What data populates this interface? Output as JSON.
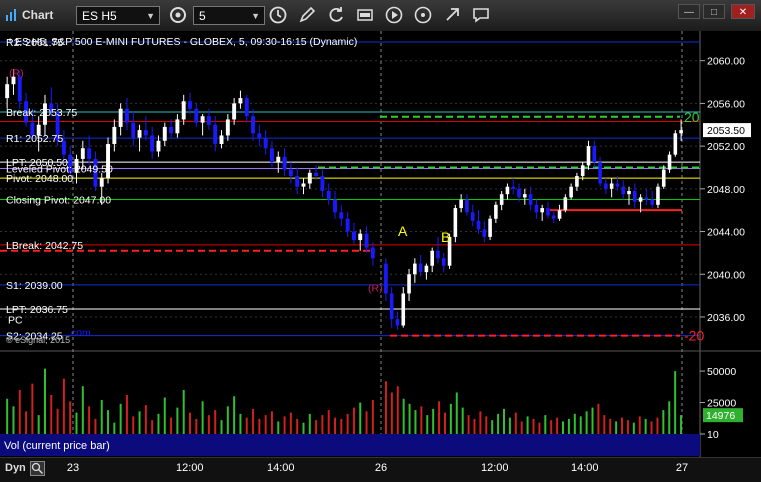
{
  "window": {
    "title": "Chart"
  },
  "toolbar": {
    "symbol": "ES H5",
    "interval": "5",
    "buttons": [
      "clock-settings-icon",
      "interval-clock-icon",
      "draw-pencil-icon",
      "refresh-icon",
      "gsc-icon",
      "play-icon",
      "link-icon",
      "chat-icon"
    ]
  },
  "window_buttons": [
    "—",
    "□",
    "✕"
  ],
  "header_text": "* ES H5, S&P 500 E-MINI FUTURES - GLOBEX, 5, 09:30-16:15 (Dynamic)",
  "header_partial_top": "R2: 2061.75",
  "watermark": "© eSignal, 2015",
  "study_label": "Vol (current price bar)",
  "bottom": {
    "mode": "Dyn"
  },
  "colors": {
    "up": "#ffffff",
    "down": "#1a1aff",
    "grid": "#333333",
    "axis_text": "#ffffff",
    "green": "#00cc00",
    "red": "#e00000",
    "yellow": "#ffff00",
    "blue_line": "#1030d0",
    "purple": "#a070ff",
    "teal": "#30c0c0"
  },
  "chart_data": {
    "type": "candlestick",
    "title": "* ES H5, S&P 500 E-MINI FUTURES - GLOBEX, 5, 09:30-16:15 (Dynamic)",
    "ylim": [
      2033.0,
      2062.5
    ],
    "y_ticks": [
      "2036.00",
      "2040.00",
      "2044.00",
      "2048.00",
      "2052.00",
      "2056.00",
      "2060.00"
    ],
    "x_ticks": [
      "23",
      "12:00",
      "14:00",
      "26",
      "12:00",
      "14:00",
      "27"
    ],
    "last_price": "2053.50",
    "levels": [
      {
        "label": "R2: 2061.75",
        "value": 2061.75,
        "color": "#1030d0",
        "style": "solid"
      },
      {
        "label": "Break: 2053.75",
        "value": 2055.2,
        "color": "#30c0c0",
        "style": "solid"
      },
      {
        "label": "",
        "value": 2054.3,
        "color": "#e00000",
        "style": "solid"
      },
      {
        "label": "R1: 2052.75",
        "value": 2052.75,
        "color": "#1030d0",
        "style": "solid"
      },
      {
        "label": "LPT: 2050.50",
        "value": 2050.5,
        "color": "#ffffff",
        "style": "solid"
      },
      {
        "label": "Leveled Pivot: 2049.50",
        "value": 2049.9,
        "color": "#a070ff",
        "style": "solid"
      },
      {
        "label": "Pivot: 2048.00",
        "value": 2049.0,
        "color": "#ffff00",
        "style": "solid"
      },
      {
        "label": "Closing Pivot: 2047.00",
        "value": 2047.0,
        "color": "#00cc00",
        "style": "solid"
      },
      {
        "label": "LBreak: 2042.75",
        "value": 2042.75,
        "color": "#e00000",
        "style": "solid"
      },
      {
        "label": "S1: 2039.00",
        "value": 2039.0,
        "color": "#1030d0",
        "style": "solid"
      },
      {
        "label": "LPT: 2036.75",
        "value": 2036.75,
        "color": "#ffffff",
        "style": "solid"
      },
      {
        "label": "S2: 2034.25",
        "value": 2034.25,
        "color": "#1030d0",
        "style": "solid"
      }
    ],
    "dashed_levels": [
      {
        "value": 2042.2,
        "color": "#ff2020",
        "x_from": 0,
        "x_to": 372
      },
      {
        "value": 2054.75,
        "color": "#33cc33",
        "x_from": 380,
        "x_to": 680,
        "tag": "20"
      },
      {
        "value": 2050.0,
        "color": "#33cc33",
        "x_from": 318,
        "x_to": 700
      },
      {
        "value": 2034.25,
        "color": "#ff2020",
        "x_from": 390,
        "x_to": 680,
        "tag": "-20"
      },
      {
        "value": 2046.0,
        "color": "#ff2020",
        "x_from": 550,
        "x_to": 682,
        "dashed": false
      }
    ],
    "annotations": [
      {
        "text": "A",
        "color": "#ffff00",
        "x": 398,
        "value": 2043.6
      },
      {
        "text": "B",
        "color": "#ffff00",
        "x": 441,
        "value": 2043.0
      },
      {
        "text": "(R)",
        "color": "#c02060",
        "x": 368,
        "value": 2038.4
      },
      {
        "text": "(R)",
        "color": "#c02060",
        "x": 9,
        "value": 2058.5
      },
      {
        "text": "PC",
        "color": "#ffffff",
        "x": 8,
        "value": 2035.4
      },
      {
        "text": ".com",
        "color": "#1a1aff",
        "x": 68,
        "value": 2034.2
      }
    ],
    "candles_day1": [
      [
        2056.5,
        2058.5,
        2055.5,
        2057.8
      ],
      [
        2057.8,
        2059.2,
        2056.8,
        2058.5
      ],
      [
        2058.5,
        2059.0,
        2055.5,
        2056.2
      ],
      [
        2056.2,
        2057.0,
        2053.8,
        2054.2
      ],
      [
        2054.2,
        2055.5,
        2052.5,
        2053.0
      ],
      [
        2053.0,
        2054.8,
        2051.5,
        2054.0
      ],
      [
        2054.0,
        2056.8,
        2053.0,
        2056.0
      ],
      [
        2056.0,
        2057.5,
        2054.8,
        2055.2
      ],
      [
        2055.2,
        2056.0,
        2052.0,
        2052.5
      ],
      [
        2052.5,
        2053.5,
        2050.5,
        2051.2
      ],
      [
        2051.2,
        2052.0,
        2049.0,
        2049.5
      ],
      [
        2049.5,
        2051.2,
        2048.5,
        2050.8
      ],
      [
        2050.8,
        2052.5,
        2049.8,
        2051.8
      ],
      [
        2051.8,
        2053.0,
        2050.2,
        2050.8
      ],
      [
        2050.8,
        2051.5,
        2047.8,
        2048.2
      ],
      [
        2048.2,
        2049.5,
        2046.5,
        2049.0
      ],
      [
        2049.0,
        2052.8,
        2048.5,
        2052.2
      ],
      [
        2052.2,
        2054.5,
        2051.5,
        2053.8
      ],
      [
        2053.8,
        2056.0,
        2053.0,
        2055.5
      ],
      [
        2055.5,
        2056.5,
        2053.5,
        2054.2
      ],
      [
        2054.2,
        2055.2,
        2052.0,
        2052.8
      ],
      [
        2052.8,
        2054.0,
        2051.5,
        2053.5
      ],
      [
        2053.5,
        2054.8,
        2052.5,
        2053.0
      ],
      [
        2053.0,
        2053.8,
        2050.8,
        2051.5
      ],
      [
        2051.5,
        2053.0,
        2051.0,
        2052.5
      ],
      [
        2052.5,
        2054.2,
        2052.0,
        2053.8
      ],
      [
        2053.8,
        2054.5,
        2052.8,
        2053.2
      ],
      [
        2053.2,
        2055.0,
        2052.8,
        2054.5
      ],
      [
        2054.5,
        2056.8,
        2054.0,
        2056.2
      ],
      [
        2056.2,
        2057.0,
        2055.0,
        2055.5
      ],
      [
        2055.5,
        2056.0,
        2053.8,
        2054.2
      ],
      [
        2054.2,
        2055.0,
        2053.0,
        2054.8
      ],
      [
        2054.8,
        2055.5,
        2053.5,
        2054.0
      ],
      [
        2054.0,
        2054.8,
        2051.5,
        2052.2
      ],
      [
        2052.2,
        2053.5,
        2051.8,
        2053.0
      ],
      [
        2053.0,
        2055.0,
        2052.5,
        2054.5
      ],
      [
        2054.5,
        2056.5,
        2054.0,
        2056.0
      ],
      [
        2056.0,
        2057.2,
        2055.5,
        2056.5
      ],
      [
        2056.5,
        2056.8,
        2054.2,
        2054.8
      ],
      [
        2054.8,
        2055.5,
        2052.5,
        2053.2
      ],
      [
        2053.2,
        2054.0,
        2052.0,
        2052.8
      ],
      [
        2052.8,
        2053.5,
        2051.2,
        2051.8
      ],
      [
        2051.8,
        2052.5,
        2050.0,
        2050.5
      ],
      [
        2050.5,
        2051.5,
        2049.5,
        2051.0
      ],
      [
        2051.0,
        2051.8,
        2049.2,
        2049.8
      ],
      [
        2049.8,
        2050.5,
        2048.5,
        2049.2
      ],
      [
        2049.2,
        2050.0,
        2047.5,
        2048.2
      ],
      [
        2048.2,
        2049.0,
        2047.5,
        2048.5
      ],
      [
        2048.5,
        2049.8,
        2048.0,
        2049.5
      ],
      [
        2049.5,
        2050.2,
        2048.8,
        2049.2
      ],
      [
        2049.2,
        2049.8,
        2047.2,
        2047.8
      ],
      [
        2047.8,
        2048.5,
        2046.5,
        2047.0
      ],
      [
        2047.0,
        2047.8,
        2045.2,
        2045.8
      ],
      [
        2045.8,
        2046.5,
        2044.5,
        2045.2
      ],
      [
        2045.2,
        2045.8,
        2043.5,
        2044.0
      ],
      [
        2044.0,
        2044.8,
        2042.8,
        2043.2
      ],
      [
        2043.2,
        2044.2,
        2042.2,
        2043.8
      ],
      [
        2043.8,
        2044.5,
        2042.0,
        2042.5
      ],
      [
        2042.5,
        2043.0,
        2040.8,
        2041.5
      ]
    ],
    "candles_day2": [
      [
        2041.0,
        2041.5,
        2037.5,
        2038.2
      ],
      [
        2038.2,
        2038.8,
        2035.0,
        2035.8
      ],
      [
        2035.8,
        2036.5,
        2034.8,
        2035.2
      ],
      [
        2035.2,
        2038.8,
        2035.0,
        2038.2
      ],
      [
        2038.2,
        2040.5,
        2037.5,
        2040.0
      ],
      [
        2040.0,
        2041.5,
        2039.2,
        2041.0
      ],
      [
        2041.0,
        2041.8,
        2039.8,
        2040.2
      ],
      [
        2040.2,
        2041.0,
        2039.5,
        2040.8
      ],
      [
        2040.8,
        2042.5,
        2040.2,
        2042.2
      ],
      [
        2042.2,
        2043.5,
        2041.0,
        2041.5
      ],
      [
        2041.5,
        2042.0,
        2040.2,
        2040.8
      ],
      [
        2040.8,
        2043.8,
        2040.5,
        2043.5
      ],
      [
        2043.5,
        2046.5,
        2043.0,
        2046.2
      ],
      [
        2046.2,
        2047.5,
        2045.8,
        2047.0
      ],
      [
        2047.0,
        2047.5,
        2045.5,
        2045.8
      ],
      [
        2045.8,
        2046.5,
        2044.5,
        2045.0
      ],
      [
        2045.0,
        2046.0,
        2043.8,
        2044.2
      ],
      [
        2044.2,
        2045.0,
        2043.0,
        2043.5
      ],
      [
        2043.5,
        2045.5,
        2043.2,
        2045.2
      ],
      [
        2045.2,
        2046.8,
        2044.8,
        2046.5
      ],
      [
        2046.5,
        2047.8,
        2046.0,
        2047.5
      ],
      [
        2047.5,
        2048.5,
        2047.0,
        2048.2
      ],
      [
        2048.2,
        2049.0,
        2047.5,
        2048.0
      ],
      [
        2048.0,
        2048.5,
        2046.8,
        2047.2
      ],
      [
        2047.2,
        2048.0,
        2046.5,
        2047.5
      ],
      [
        2047.5,
        2048.2,
        2046.0,
        2046.5
      ],
      [
        2046.5,
        2047.0,
        2045.2,
        2045.8
      ],
      [
        2045.8,
        2046.5,
        2045.0,
        2046.2
      ],
      [
        2046.2,
        2046.8,
        2045.2,
        2045.5
      ],
      [
        2045.5,
        2046.0,
        2044.8,
        2045.2
      ],
      [
        2045.2,
        2046.5,
        2045.0,
        2046.0
      ],
      [
        2046.0,
        2047.5,
        2045.8,
        2047.2
      ],
      [
        2047.2,
        2048.5,
        2047.0,
        2048.2
      ],
      [
        2048.2,
        2049.5,
        2047.8,
        2049.2
      ],
      [
        2049.2,
        2050.5,
        2048.8,
        2050.2
      ],
      [
        2050.2,
        2052.5,
        2049.8,
        2052.0
      ],
      [
        2052.0,
        2052.5,
        2050.0,
        2050.5
      ],
      [
        2050.5,
        2051.0,
        2048.2,
        2048.5
      ],
      [
        2048.5,
        2049.0,
        2047.5,
        2048.0
      ],
      [
        2048.0,
        2049.0,
        2047.2,
        2048.5
      ],
      [
        2048.5,
        2049.2,
        2047.8,
        2048.2
      ],
      [
        2048.2,
        2048.8,
        2047.0,
        2047.5
      ],
      [
        2047.5,
        2048.2,
        2046.5,
        2047.8
      ],
      [
        2047.8,
        2048.5,
        2046.2,
        2046.8
      ],
      [
        2046.8,
        2047.5,
        2045.8,
        2047.2
      ],
      [
        2047.2,
        2048.0,
        2046.5,
        2047.0
      ],
      [
        2047.0,
        2047.8,
        2046.2,
        2046.5
      ],
      [
        2046.5,
        2048.5,
        2046.2,
        2048.2
      ],
      [
        2048.2,
        2050.2,
        2048.0,
        2049.8
      ],
      [
        2049.8,
        2051.5,
        2049.5,
        2051.2
      ],
      [
        2051.2,
        2053.5,
        2051.0,
        2053.2
      ],
      [
        2053.2,
        2054.5,
        2052.5,
        2053.5
      ]
    ],
    "volume": {
      "ylim": [
        0,
        62000
      ],
      "y_ticks": [
        "50000",
        "25000",
        "10"
      ],
      "last_value": "14976",
      "values_day1": [
        28000,
        22000,
        35000,
        18000,
        40000,
        15000,
        52000,
        31000,
        20000,
        44000,
        26000,
        17000,
        38000,
        22000,
        12000,
        27000,
        19000,
        9000,
        24000,
        31000,
        14000,
        18000,
        23000,
        11000,
        16000,
        29000,
        13000,
        21000,
        35000,
        17000,
        12000,
        26000,
        15000,
        19000,
        11000,
        22000,
        30000,
        16000,
        13000,
        20000,
        12000,
        15000,
        18000,
        10000,
        14000,
        17000,
        12000,
        9000,
        16000,
        11000,
        15000,
        19000,
        13000,
        12000,
        16000,
        21000,
        25000,
        18000,
        27000
      ],
      "values_day2": [
        42000,
        33000,
        38000,
        28000,
        24000,
        19000,
        22000,
        15000,
        20000,
        26000,
        17000,
        24000,
        33000,
        21000,
        15000,
        12000,
        18000,
        14000,
        11000,
        16000,
        20000,
        13000,
        17000,
        10000,
        14000,
        12000,
        9000,
        15000,
        11000,
        13000,
        10000,
        12000,
        16000,
        14000,
        18000,
        21000,
        24000,
        15000,
        12000,
        10000,
        13000,
        11000,
        9000,
        14000,
        12000,
        10000,
        13000,
        19000,
        26000,
        50000,
        14976
      ]
    }
  }
}
